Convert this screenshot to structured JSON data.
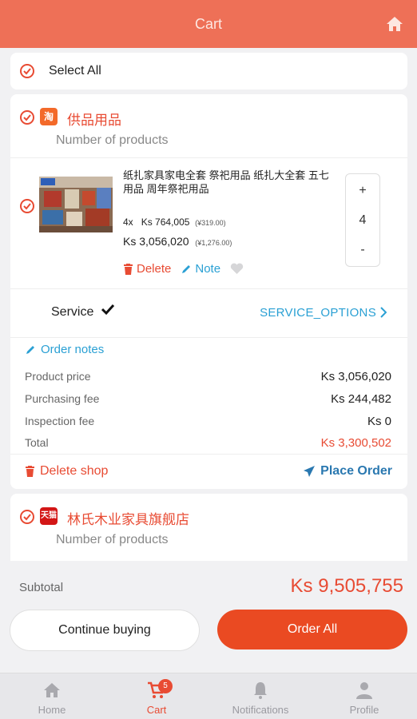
{
  "header": {
    "title": "Cart"
  },
  "select_all": {
    "label": "Select All"
  },
  "shops": [
    {
      "badge": "淘",
      "name": "供品用品",
      "count_label": "Number of products",
      "product": {
        "name": "纸扎家具家电全套 祭祀用品 纸扎大全套 五七用品 周年祭祀用品",
        "qty": "4x",
        "unit_price": "Ks 764,005",
        "unit_price_cny": "(¥319.00)",
        "total_price": "Ks 3,056,020",
        "total_price_cny": "(¥1,276.00)",
        "delete_label": "Delete",
        "note_label": "Note",
        "stepper": {
          "plus": "+",
          "value": "4",
          "minus": "-"
        }
      },
      "service": {
        "label": "Service",
        "options_label": "SERVICE_OPTIONS"
      },
      "order_notes_label": "Order notes",
      "fees": [
        {
          "label": "Product price",
          "value": "Ks 3,056,020"
        },
        {
          "label": "Purchasing fee",
          "value": "Ks 244,482"
        },
        {
          "label": "Inspection fee",
          "value": "Ks 0"
        },
        {
          "label": "Total",
          "value": "Ks 3,300,502"
        }
      ],
      "delete_shop_label": "Delete shop",
      "place_order_label": "Place Order"
    },
    {
      "badge": "天猫",
      "name": "林氏木业家具旗舰店",
      "count_label": "Number of products"
    }
  ],
  "footer": {
    "subtotal_label": "Subtotal",
    "subtotal_value": "Ks 9,505,755",
    "continue_label": "Continue buying",
    "order_all_label": "Order All"
  },
  "nav": {
    "items": [
      {
        "label": "Home",
        "icon": "home-icon"
      },
      {
        "label": "Cart",
        "icon": "cart-icon",
        "badge": "5"
      },
      {
        "label": "Notifications",
        "icon": "bell-icon"
      },
      {
        "label": "Profile",
        "icon": "person-icon"
      }
    ]
  },
  "colors": {
    "header": "#ee7057",
    "accent": "#e84b33",
    "link": "#2aa0d4",
    "order_all": "#ea4a22"
  }
}
